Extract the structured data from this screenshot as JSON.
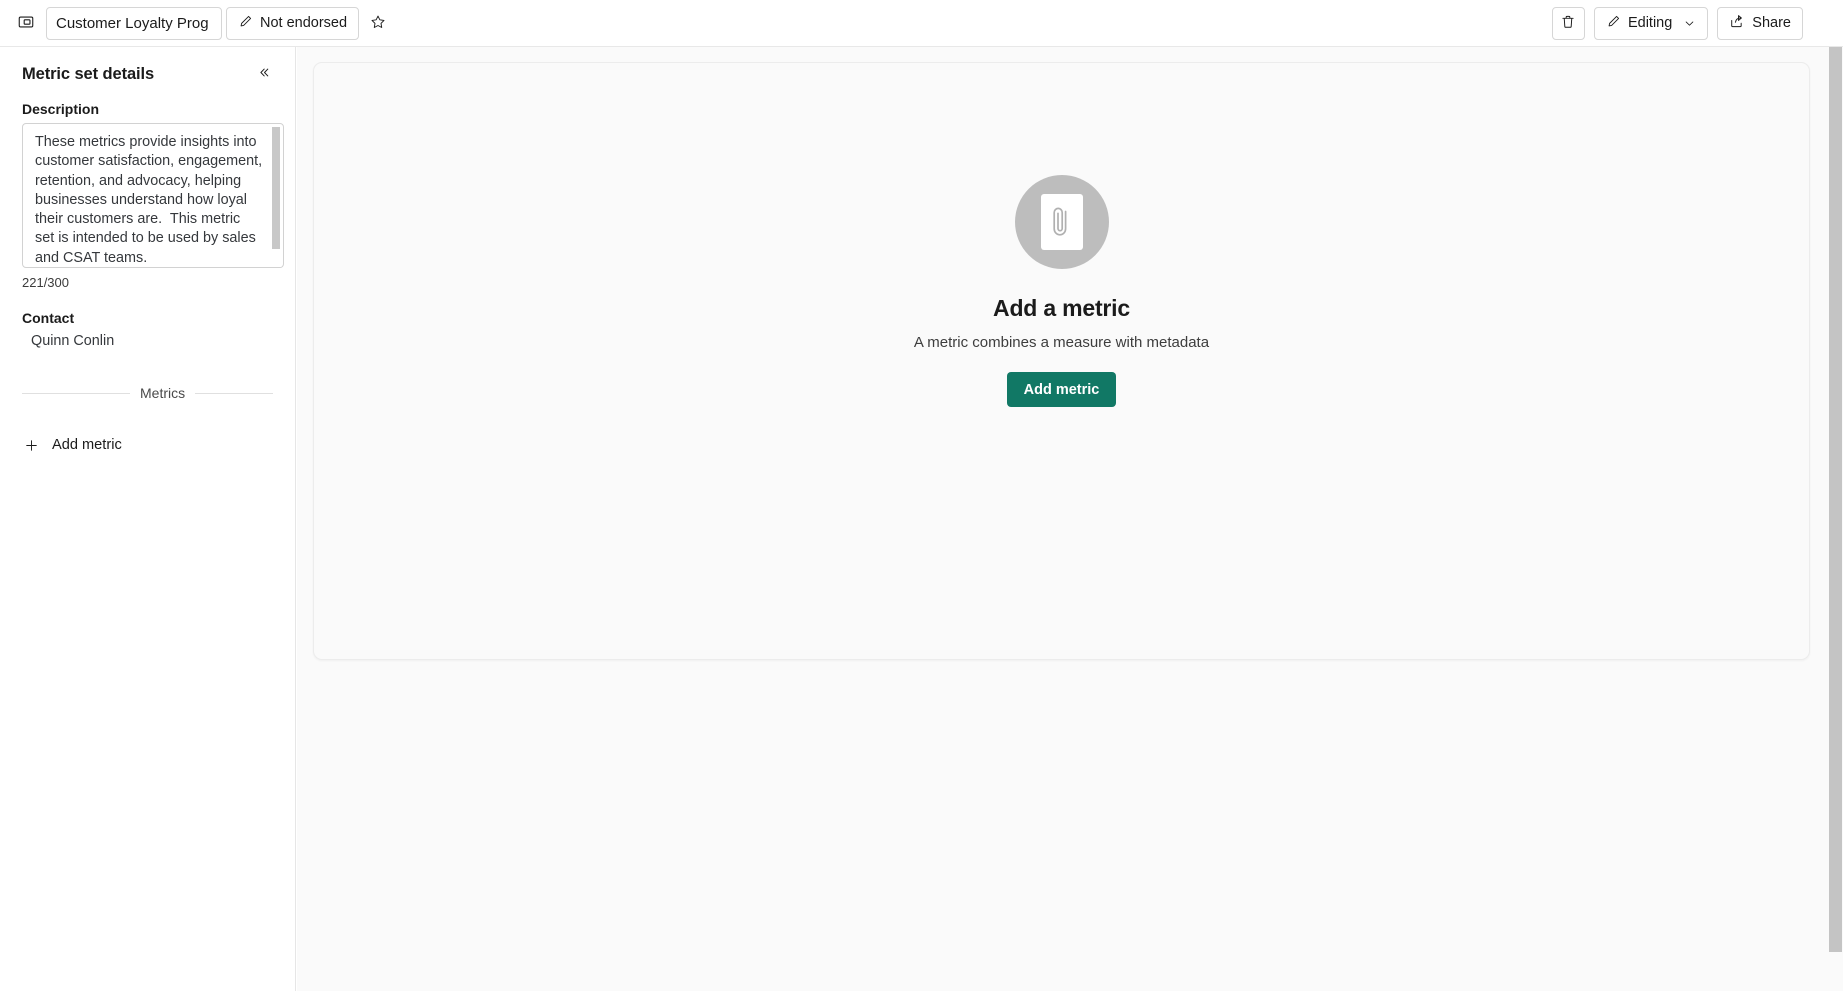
{
  "topbar": {
    "panel_toggle_icon": "panel-toggle-icon",
    "title_value": "Customer Loyalty Prog",
    "title_placeholder": "Metric set name",
    "endorsement_label": "Not endorsed",
    "endorsement_icon": "pencil-icon",
    "favorite_icon": "star-icon",
    "delete_icon": "trash-icon",
    "editing_label": "Editing",
    "editing_icon": "pencil-icon",
    "editing_caret_icon": "chevron-down-icon",
    "share_label": "Share",
    "share_icon": "share-icon"
  },
  "sidepane": {
    "title": "Metric set details",
    "collapse_icon": "double-chevron-left-icon",
    "description_label": "Description",
    "description_value": "These metrics provide insights into customer satisfaction, engagement, retention, and advocacy, helping businesses understand how loyal their customers are.  This metric set is intended to be used by sales and CSAT teams.",
    "char_count": "221/300",
    "contact_label": "Contact",
    "contact_value": "Quinn Conlin",
    "metrics_divider_label": "Metrics",
    "add_metric_label": "Add metric",
    "add_metric_icon": "plus-icon"
  },
  "canvas": {
    "empty_state": {
      "illustration_icon": "paperclip-document-icon",
      "title": "Add a metric",
      "subtitle": "A metric combines a measure with metadata",
      "button_label": "Add metric"
    }
  },
  "colors": {
    "accent_green": "#117865",
    "canvas_bg": "#fafafa",
    "border": "#e6e6e6",
    "illustration_gray": "#bdbdbd",
    "scrollbar_thumb": "#c4c4c4"
  }
}
